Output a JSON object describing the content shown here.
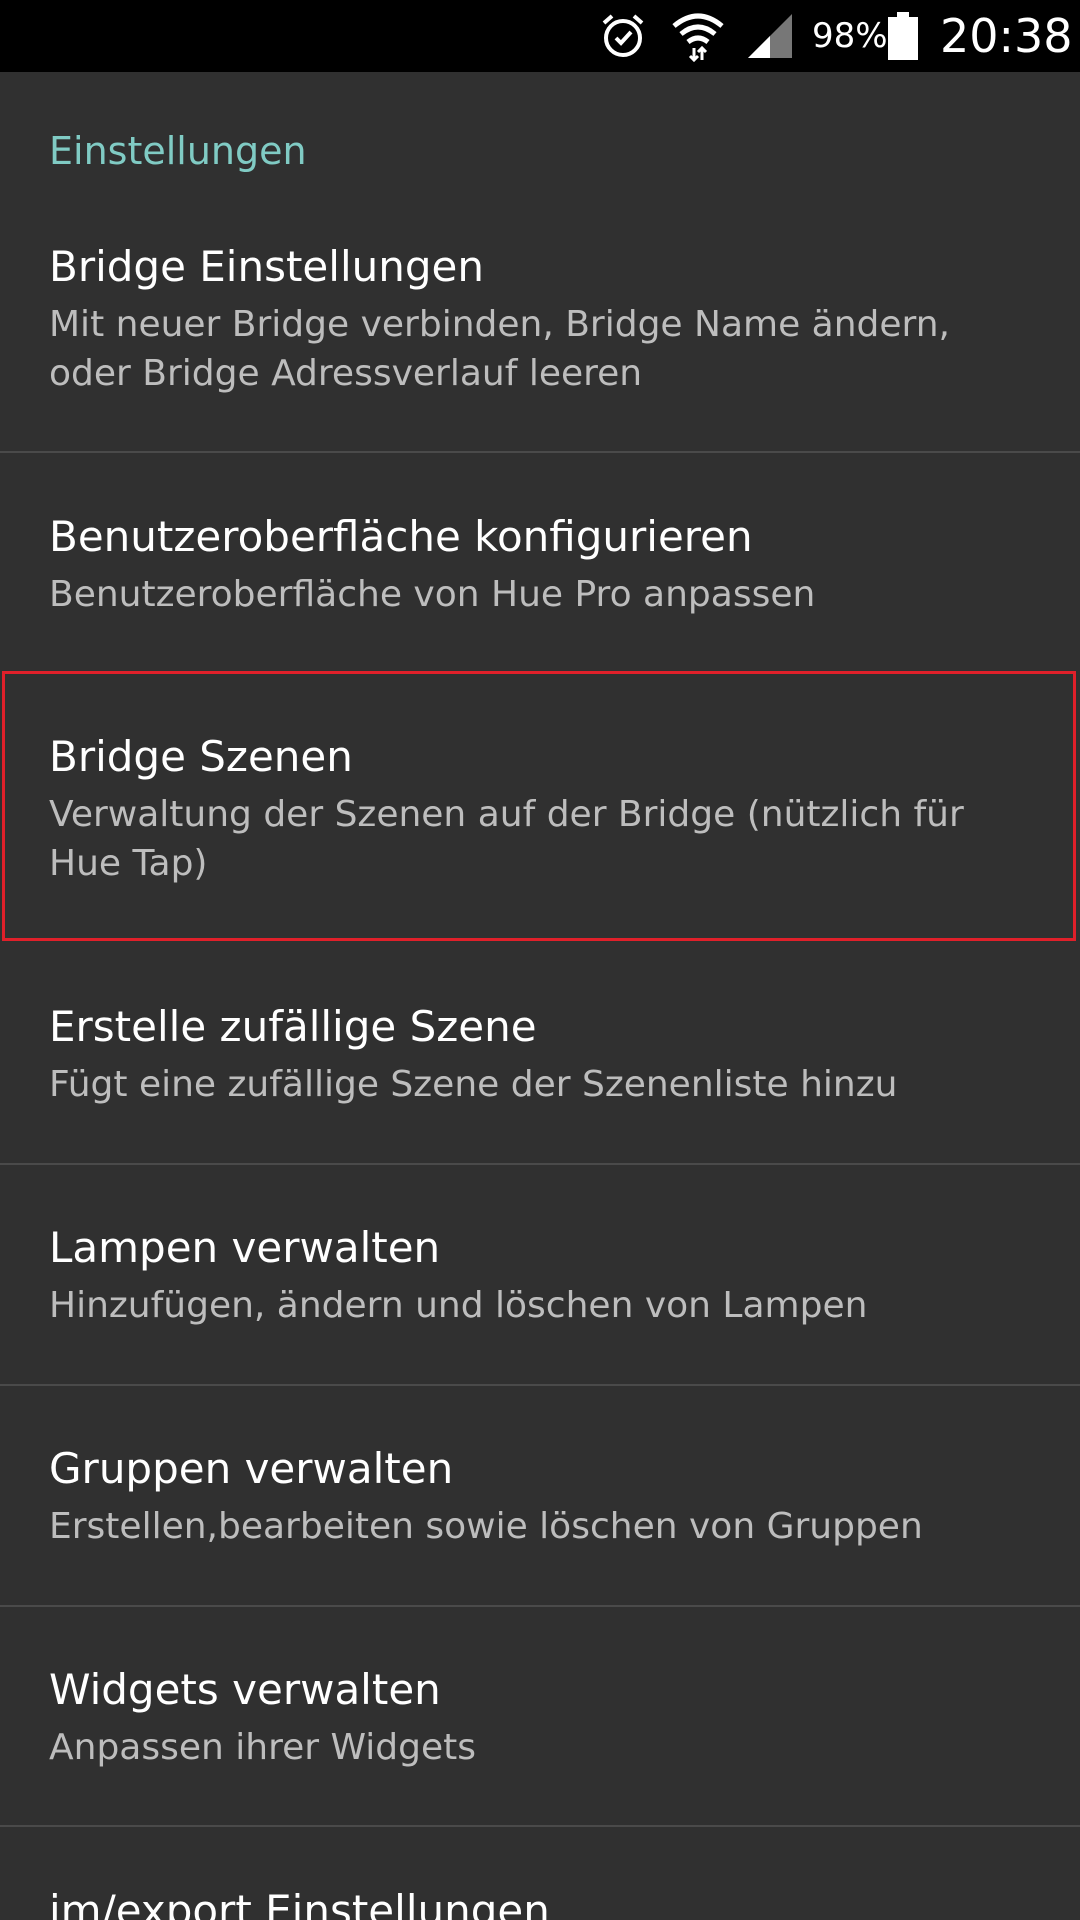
{
  "status_bar": {
    "battery_percent": "98%",
    "time": "20:38",
    "icons": [
      "alarm-icon",
      "wifi-icon",
      "signal-icon",
      "battery-icon"
    ]
  },
  "section": {
    "title": "Einstellungen"
  },
  "items": [
    {
      "title": "Bridge Einstellungen",
      "summary": "Mit neuer Bridge verbinden, Bridge Name ändern, oder Bridge Adressverlauf leeren"
    },
    {
      "title": "Benutzeroberfläche konfigurieren",
      "summary": "Benutzeroberfläche von Hue Pro anpassen"
    },
    {
      "title": "Bridge Szenen",
      "summary": "Verwaltung der Szenen auf der Bridge (nützlich für Hue Tap)"
    },
    {
      "title": "Erstelle zufällige Szene",
      "summary": "Fügt eine zufällige Szene der Szenenliste hinzu"
    },
    {
      "title": "Lampen verwalten",
      "summary": "Hinzufügen, ändern und löschen von Lampen"
    },
    {
      "title": "Gruppen verwalten",
      "summary": "Erstellen,bearbeiten sowie löschen von Gruppen"
    },
    {
      "title": "Widgets verwalten",
      "summary": "Anpassen ihrer Widgets"
    },
    {
      "title": "im/export Einstellungen",
      "summary": ""
    }
  ],
  "colors": {
    "accent": "#80cbc4",
    "background": "#303030",
    "highlight": "#e0202a"
  }
}
